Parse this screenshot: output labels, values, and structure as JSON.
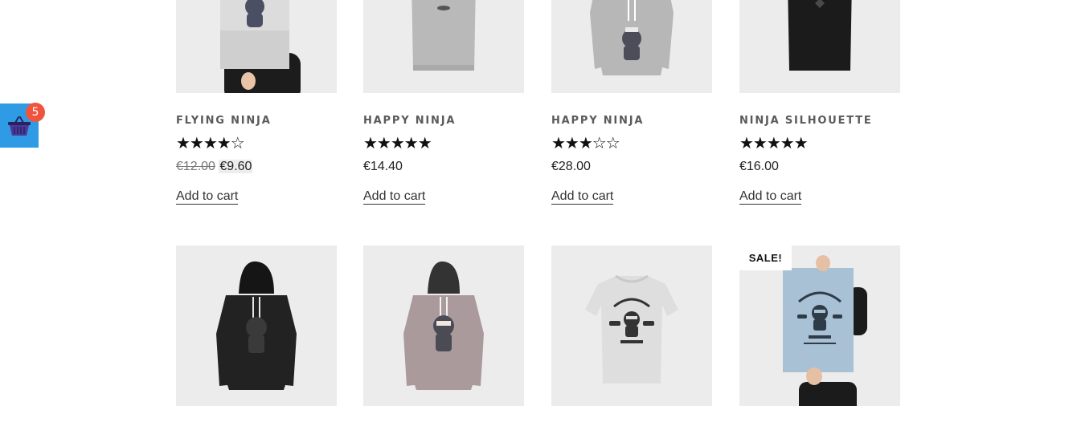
{
  "cart": {
    "count": "5",
    "icon": "basket-icon",
    "color": "#2f9be4",
    "badge_color": "#f0533e"
  },
  "products": [
    {
      "title": "FLYING NINJA",
      "rating": 4,
      "stars": "★★★★☆",
      "old_price": "€12.00",
      "price": "€9.60",
      "cta": "Add to cart",
      "image": "poster-held-image"
    },
    {
      "title": "HAPPY NINJA",
      "rating": 5,
      "stars": "★★★★★",
      "price": "€14.40",
      "cta": "Add to cart",
      "image": "grey-tshirt-image"
    },
    {
      "title": "HAPPY NINJA",
      "rating": 3,
      "stars": "★★★☆☆",
      "price": "€28.00",
      "cta": "Add to cart",
      "image": "grey-hoodie-image"
    },
    {
      "title": "NINJA SILHOUETTE",
      "rating": 5,
      "stars": "★★★★★",
      "price": "€16.00",
      "cta": "Add to cart",
      "image": "black-tshirt-image"
    }
  ],
  "row2": [
    {
      "image": "black-hoodie-image"
    },
    {
      "image": "pink-hoodie-image"
    },
    {
      "image": "white-tshirt-image"
    },
    {
      "image": "poster-held-image",
      "badge": "SALE!"
    }
  ],
  "colors": {
    "thumb_bg": "#ececec",
    "title": "#5a5a5a",
    "text": "#222222"
  }
}
